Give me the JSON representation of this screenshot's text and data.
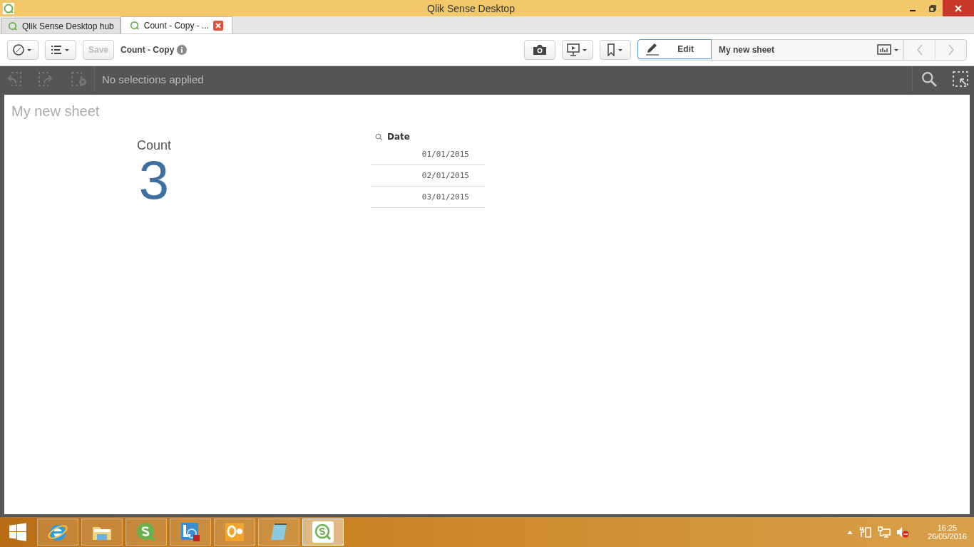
{
  "window": {
    "title": "Qlik Sense Desktop"
  },
  "tabs": [
    {
      "label": "Qlik Sense Desktop hub",
      "selected": false,
      "closable": false
    },
    {
      "label": "Count - Copy - ...",
      "selected": true,
      "closable": true
    }
  ],
  "toolbar": {
    "save": {
      "label": "Save",
      "disabled": true
    },
    "app_title": "Count - Copy",
    "edit": {
      "label": "Edit",
      "selected": true
    },
    "sheet_name": "My new sheet"
  },
  "selections_bar": {
    "text": "No selections applied"
  },
  "sheet": {
    "title": "My new sheet",
    "kpi": {
      "label": "Count",
      "value": "3"
    },
    "filter_pane": {
      "title": "Date",
      "rows": [
        "01/01/2015",
        "02/01/2015",
        "03/01/2015"
      ]
    }
  },
  "taskbar": {
    "apps": [
      {
        "kind": "browser",
        "selected": false
      },
      {
        "kind": "folder",
        "selected": false
      },
      {
        "kind": "qlik",
        "selected": false
      },
      {
        "kind": "lync",
        "selected": false
      },
      {
        "kind": "outlook",
        "selected": false
      },
      {
        "kind": "notepad",
        "selected": false
      },
      {
        "kind": "qlik-white",
        "selected": true
      }
    ],
    "time": "16:25",
    "date": "26/05/2016"
  }
}
